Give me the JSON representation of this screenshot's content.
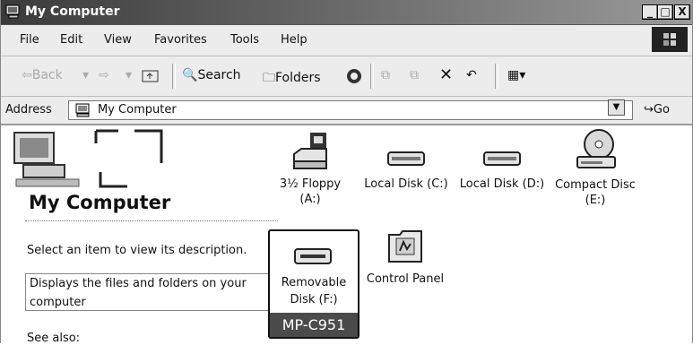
{
  "window": {
    "title": "My Computer"
  },
  "titlebar": {
    "minimize": "_",
    "maximize": "□",
    "close": "X"
  },
  "menu": [
    "File",
    "Edit",
    "View",
    "Favorites",
    "Tools",
    "Help"
  ],
  "toolbar": {
    "back_label": "Back",
    "search_label": "Search",
    "folders_label": "Folders"
  },
  "address": {
    "label": "Address",
    "value": "My Computer",
    "go_label": "Go"
  },
  "left_pane": {
    "title": "My Computer",
    "select_prompt": "Select an item to view its description.",
    "description_line1": "Displays the files and folders on your",
    "description_line2": "computer",
    "see_also": "See also:"
  },
  "items": {
    "floppy": {
      "line1": "3½ Floppy",
      "line2": "(A:)"
    },
    "local_c": {
      "line1": "Local Disk (C:)"
    },
    "local_d": {
      "line1": "Local Disk (D:)"
    },
    "compact_disc": {
      "line1": "Compact Disc",
      "line2": "(E:)"
    },
    "removable": {
      "line1": "Removable",
      "line2": "Disk (F:)",
      "badge": "MP-C951"
    },
    "control_panel": {
      "line1": "Control Panel"
    }
  }
}
